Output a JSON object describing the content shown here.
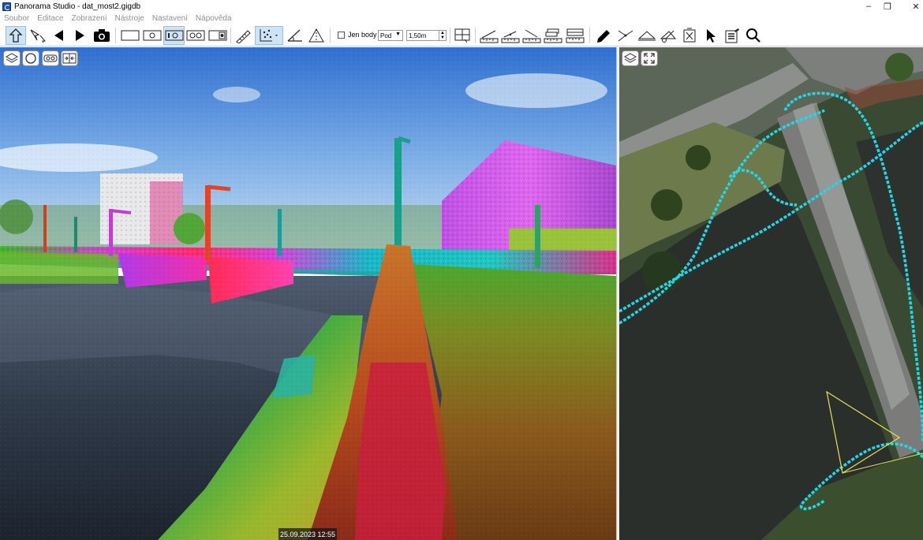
{
  "window": {
    "title": "Panorama Studio - dat_most2.gigdb",
    "minimize_symbol": "–",
    "restore_symbol": "❐",
    "close_symbol": "✕"
  },
  "menu": {
    "items": [
      {
        "label": "Soubor"
      },
      {
        "label": "Editace"
      },
      {
        "label": "Zobrazení"
      },
      {
        "label": "Nástroje"
      },
      {
        "label": "Nastavení"
      },
      {
        "label": "Nápověda"
      }
    ]
  },
  "toolbar": {
    "jen_body_label": "Jen body",
    "jen_body_checked": false,
    "vertical_select_value": "Pod",
    "distance_value": "1,50m",
    "active_tools": [
      "navigate",
      "view-single-circle",
      "point-picking"
    ]
  },
  "panorama": {
    "timestamp": "25.09.2023 12:55"
  },
  "colors": {
    "accent_active": "#cde3f6",
    "trajectory": "#22d8e8",
    "view_cone": "#e6e24a",
    "menu_text_disabled": "#909090"
  }
}
